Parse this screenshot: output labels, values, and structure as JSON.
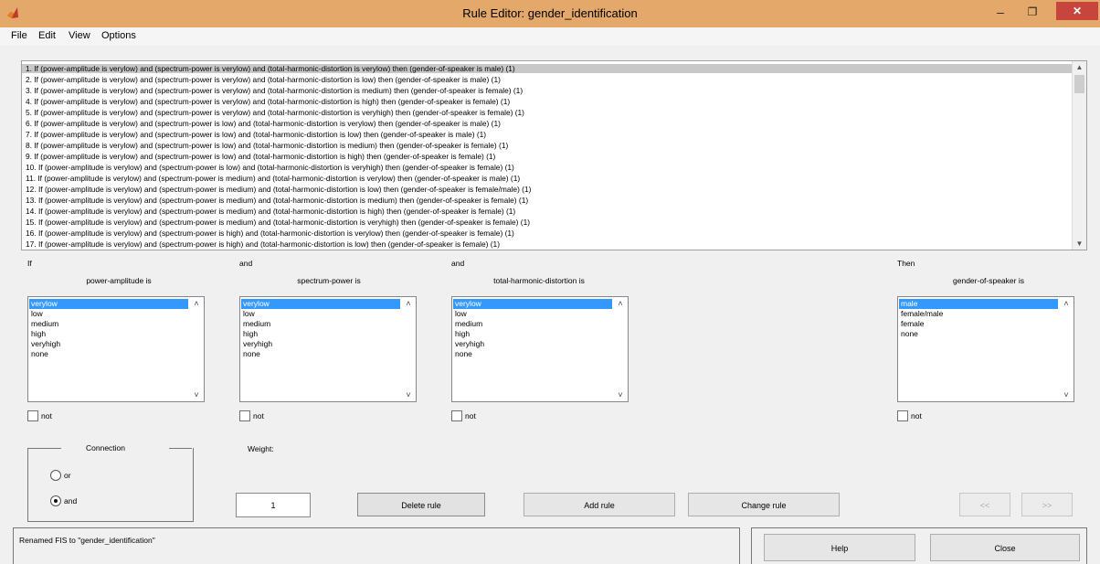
{
  "window": {
    "title": "Rule Editor: gender_identification",
    "minimize": "–",
    "maximize": "❐",
    "close": "✕"
  },
  "menu": [
    "File",
    "Edit",
    "View",
    "Options"
  ],
  "rules": [
    "1. If (power-amplitude is verylow) and (spectrum-power is verylow) and (total-harmonic-distortion is verylow) then (gender-of-speaker is male) (1)",
    "2. If (power-amplitude is verylow) and (spectrum-power is verylow) and (total-harmonic-distortion is low) then (gender-of-speaker is male) (1)",
    "3. If (power-amplitude is verylow) and (spectrum-power is verylow) and (total-harmonic-distortion is medium) then (gender-of-speaker is female) (1)",
    "4. If (power-amplitude is verylow) and (spectrum-power is verylow) and (total-harmonic-distortion is high) then (gender-of-speaker is female) (1)",
    "5. If (power-amplitude is verylow) and (spectrum-power is verylow) and (total-harmonic-distortion is veryhigh) then (gender-of-speaker is female) (1)",
    "6. If (power-amplitude is verylow) and (spectrum-power is low) and (total-harmonic-distortion is verylow) then (gender-of-speaker is male) (1)",
    "7. If (power-amplitude is verylow) and (spectrum-power is low) and (total-harmonic-distortion is low) then (gender-of-speaker is male) (1)",
    "8. If (power-amplitude is verylow) and (spectrum-power is low) and (total-harmonic-distortion is medium) then (gender-of-speaker is female) (1)",
    "9. If (power-amplitude is verylow) and (spectrum-power is low) and (total-harmonic-distortion is high) then (gender-of-speaker is female) (1)",
    "10. If (power-amplitude is verylow) and (spectrum-power is low) and (total-harmonic-distortion is veryhigh) then (gender-of-speaker is female) (1)",
    "11. If (power-amplitude is verylow) and (spectrum-power is medium) and (total-harmonic-distortion is verylow) then (gender-of-speaker is male) (1)",
    "12. If (power-amplitude is verylow) and (spectrum-power is medium) and (total-harmonic-distortion is low) then (gender-of-speaker is female/male) (1)",
    "13. If (power-amplitude is verylow) and (spectrum-power is medium) and (total-harmonic-distortion is medium) then (gender-of-speaker is female) (1)",
    "14. If (power-amplitude is verylow) and (spectrum-power is medium) and (total-harmonic-distortion is high) then (gender-of-speaker is female) (1)",
    "15. If (power-amplitude is verylow) and (spectrum-power is medium) and (total-harmonic-distortion is veryhigh) then (gender-of-speaker is female) (1)",
    "16. If (power-amplitude is verylow) and (spectrum-power is high) and (total-harmonic-distortion is verylow) then (gender-of-speaker is female) (1)",
    "17. If (power-amplitude is verylow) and (spectrum-power is high) and (total-harmonic-distortion is low) then (gender-of-speaker is female) (1)"
  ],
  "labels": {
    "if": "If",
    "and1": "and",
    "and2": "and",
    "then": "Then",
    "not": "not",
    "connection": "Connection",
    "weight": "Weight:"
  },
  "inputs": [
    {
      "title": "power-amplitude is",
      "options": [
        "verylow",
        "low",
        "medium",
        "high",
        "veryhigh",
        "none"
      ],
      "selected": 0
    },
    {
      "title": "spectrum-power is",
      "options": [
        "verylow",
        "low",
        "medium",
        "high",
        "veryhigh",
        "none"
      ],
      "selected": 0
    },
    {
      "title": "total-harmonic-distortion is",
      "options": [
        "verylow",
        "low",
        "medium",
        "high",
        "veryhigh",
        "none"
      ],
      "selected": 0
    }
  ],
  "output": {
    "title": "gender-of-speaker is",
    "options": [
      "male",
      "female/male",
      "female",
      "none"
    ],
    "selected": 0
  },
  "connection": {
    "options": [
      "or",
      "and"
    ],
    "selected": "and"
  },
  "weight": "1",
  "buttons": {
    "delete": "Delete rule",
    "add": "Add rule",
    "change": "Change rule",
    "prev": "<<",
    "next": ">>",
    "help": "Help",
    "close": "Close"
  },
  "status": "Renamed FIS to \"gender_identification\"",
  "colors": {
    "titlebar": "#e4a86a",
    "selection": "#3399ff",
    "rule_selection": "#c8c8c8"
  }
}
